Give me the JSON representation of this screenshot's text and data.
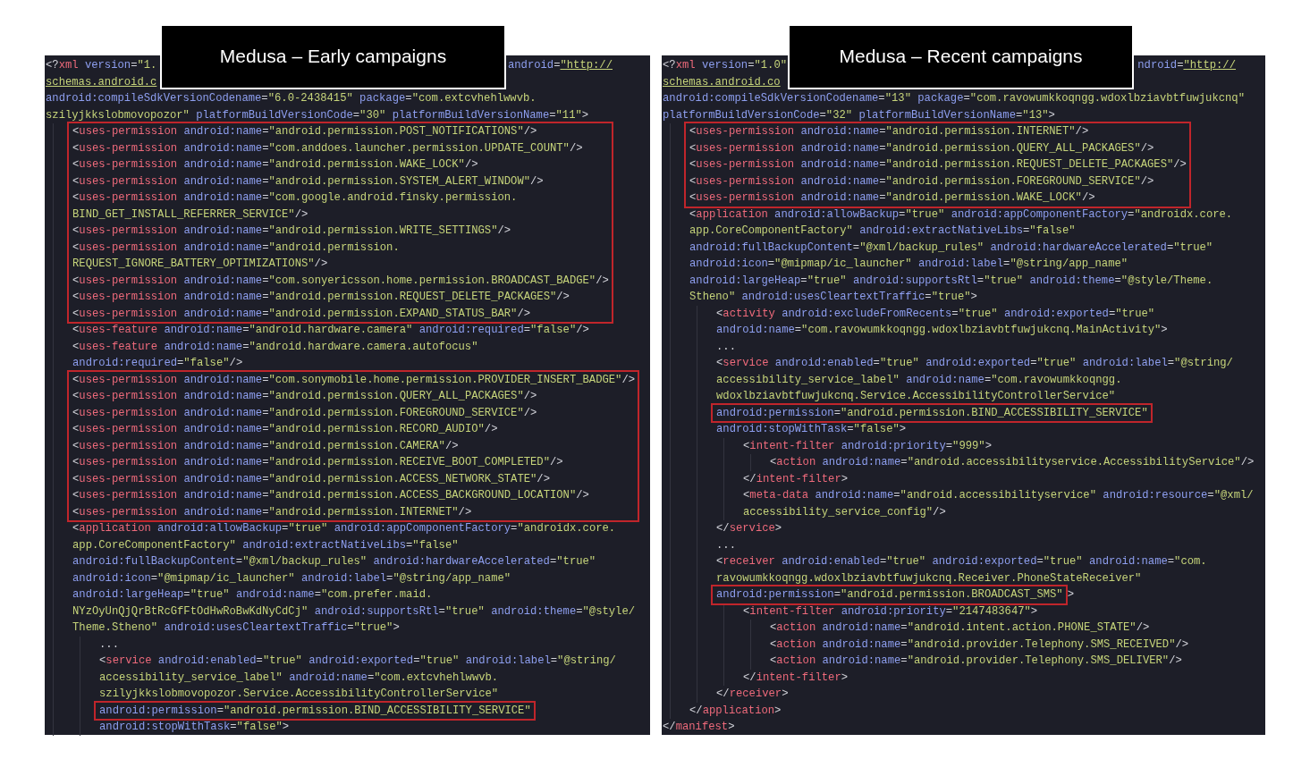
{
  "panels": [
    {
      "title": "Medusa – Early campaigns",
      "code": [
        {
          "kind": "split",
          "parts": [
            {
              "text": "<?xml version=\"1."
            },
            {
              "text": "android=\"http://",
              "link": true
            }
          ]
        },
        {
          "kind": "line",
          "text": "schemas.android.c",
          "starts_in_value": true,
          "link": true
        },
        {
          "kind": "line",
          "text": "android:compileSdkVersionCodename=\"6.0-2438415\" package=\"com.extcvhehlwwvb."
        },
        {
          "kind": "line",
          "text": "szilyjkkslobmovopozor\" platformBuildVersionCode=\"30\" platformBuildVersionName=\"11\">",
          "starts_in_value": true,
          "children": [
            {
              "kind": "highlight",
              "lines": [
                {
                  "text": "<uses-permission android:name=\"android.permission.POST_NOTIFICATIONS\"/>"
                },
                {
                  "text": "<uses-permission android:name=\"com.anddoes.launcher.permission.UPDATE_COUNT\"/>"
                },
                {
                  "text": "<uses-permission android:name=\"android.permission.WAKE_LOCK\"/>"
                },
                {
                  "text": "<uses-permission android:name=\"android.permission.SYSTEM_ALERT_WINDOW\"/>"
                },
                {
                  "text": "<uses-permission android:name=\"com.google.android.finsky.permission."
                },
                {
                  "text": "BIND_GET_INSTALL_REFERRER_SERVICE\"/>",
                  "starts_in_value": true
                },
                {
                  "text": "<uses-permission android:name=\"android.permission.WRITE_SETTINGS\"/>"
                },
                {
                  "text": "<uses-permission android:name=\"android.permission."
                },
                {
                  "text": "REQUEST_IGNORE_BATTERY_OPTIMIZATIONS\"/>",
                  "starts_in_value": true
                },
                {
                  "text": "<uses-permission android:name=\"com.sonyericsson.home.permission.BROADCAST_BADGE\"/>"
                },
                {
                  "text": "<uses-permission android:name=\"android.permission.REQUEST_DELETE_PACKAGES\"/>"
                },
                {
                  "text": "<uses-permission android:name=\"android.permission.EXPAND_STATUS_BAR\"/>"
                }
              ]
            },
            {
              "kind": "line",
              "text": "<uses-feature android:name=\"android.hardware.camera\" android:required=\"false\"/>"
            },
            {
              "kind": "line",
              "text": "<uses-feature android:name=\"android.hardware.camera.autofocus\""
            },
            {
              "kind": "line",
              "text": "android:required=\"false\"/>"
            },
            {
              "kind": "highlight",
              "lines": [
                {
                  "text": "<uses-permission android:name=\"com.sonymobile.home.permission.PROVIDER_INSERT_BADGE\"/>"
                },
                {
                  "text": "<uses-permission android:name=\"android.permission.QUERY_ALL_PACKAGES\"/>"
                },
                {
                  "text": "<uses-permission android:name=\"android.permission.FOREGROUND_SERVICE\"/>"
                },
                {
                  "text": "<uses-permission android:name=\"android.permission.RECORD_AUDIO\"/>"
                },
                {
                  "text": "<uses-permission android:name=\"android.permission.CAMERA\"/>"
                },
                {
                  "text": "<uses-permission android:name=\"android.permission.RECEIVE_BOOT_COMPLETED\"/>"
                },
                {
                  "text": "<uses-permission android:name=\"android.permission.ACCESS_NETWORK_STATE\"/>"
                },
                {
                  "text": "<uses-permission android:name=\"android.permission.ACCESS_BACKGROUND_LOCATION\"/>"
                },
                {
                  "text": "<uses-permission android:name=\"android.permission.INTERNET\"/>"
                }
              ]
            },
            {
              "kind": "line",
              "text": "<application android:allowBackup=\"true\" android:appComponentFactory=\"androidx.core."
            },
            {
              "kind": "line",
              "text": "app.CoreComponentFactory\" android:extractNativeLibs=\"false\"",
              "starts_in_value": true
            },
            {
              "kind": "line",
              "text": "android:fullBackupContent=\"@xml/backup_rules\" android:hardwareAccelerated=\"true\""
            },
            {
              "kind": "line",
              "text": "android:icon=\"@mipmap/ic_launcher\" android:label=\"@string/app_name\""
            },
            {
              "kind": "line",
              "text": "android:largeHeap=\"true\" android:name=\"com.prefer.maid."
            },
            {
              "kind": "line",
              "text": "NYzOyUnQjQrBtRcGfFtOdHwRoBwKdNyCdCj\" android:supportsRtl=\"true\" android:theme=\"@style/",
              "starts_in_value": true
            },
            {
              "kind": "line",
              "text": "Theme.Stheno\" android:usesCleartextTraffic=\"true\">",
              "starts_in_value": true,
              "children": [
                {
                  "kind": "line",
                  "text": "..."
                },
                {
                  "kind": "line",
                  "text": "<service android:enabled=\"true\" android:exported=\"true\" android:label=\"@string/"
                },
                {
                  "kind": "line",
                  "text": "accessibility_service_label\" android:name=\"com.extcvhehlwwvb.",
                  "starts_in_value": true
                },
                {
                  "kind": "line",
                  "text": "szilyjkkslobmovopozor.Service.AccessibilityControllerService\"",
                  "starts_in_value": true
                },
                {
                  "kind": "highlight",
                  "lines": [
                    {
                      "text": "android:permission=\"android.permission.BIND_ACCESSIBILITY_SERVICE\""
                    }
                  ]
                },
                {
                  "kind": "line",
                  "text": "android:stopWithTask=\"false\">"
                }
              ]
            }
          ]
        }
      ]
    },
    {
      "title": "Medusa – Recent campaigns",
      "code": [
        {
          "kind": "split",
          "parts": [
            {
              "text": "<?xml version=\"1.0\""
            },
            {
              "text": "ndroid=\"http://",
              "link": true
            }
          ]
        },
        {
          "kind": "line",
          "text": "schemas.android.co",
          "starts_in_value": true,
          "link": true
        },
        {
          "kind": "line",
          "text": "android:compileSdkVersionCodename=\"13\" package=\"com.ravowumkkoqngg.wdoxlbziavbtfuwjukcnq\""
        },
        {
          "kind": "line",
          "text": "platformBuildVersionCode=\"32\" platformBuildVersionName=\"13\">",
          "children": [
            {
              "kind": "highlight",
              "lines": [
                {
                  "text": "<uses-permission android:name=\"android.permission.INTERNET\"/>"
                },
                {
                  "text": "<uses-permission android:name=\"android.permission.QUERY_ALL_PACKAGES\"/>"
                },
                {
                  "text": "<uses-permission android:name=\"android.permission.REQUEST_DELETE_PACKAGES\"/>"
                },
                {
                  "text": "<uses-permission android:name=\"android.permission.FOREGROUND_SERVICE\"/>"
                },
                {
                  "text": "<uses-permission android:name=\"android.permission.WAKE_LOCK\"/>"
                }
              ]
            },
            {
              "kind": "line",
              "text": "<application android:allowBackup=\"true\" android:appComponentFactory=\"androidx.core."
            },
            {
              "kind": "line",
              "text": "app.CoreComponentFactory\" android:extractNativeLibs=\"false\"",
              "starts_in_value": true
            },
            {
              "kind": "line",
              "text": "android:fullBackupContent=\"@xml/backup_rules\" android:hardwareAccelerated=\"true\""
            },
            {
              "kind": "line",
              "text": "android:icon=\"@mipmap/ic_launcher\" android:label=\"@string/app_name\""
            },
            {
              "kind": "line",
              "text": "android:largeHeap=\"true\" android:supportsRtl=\"true\" android:theme=\"@style/Theme."
            },
            {
              "kind": "line",
              "text": "Stheno\" android:usesCleartextTraffic=\"true\">",
              "starts_in_value": true,
              "children": [
                {
                  "kind": "line",
                  "text": "<activity android:excludeFromRecents=\"true\" android:exported=\"true\""
                },
                {
                  "kind": "line",
                  "text": "android:name=\"com.ravowumkkoqngg.wdoxlbziavbtfuwjukcnq.MainActivity\">"
                },
                {
                  "kind": "line",
                  "text": "..."
                },
                {
                  "kind": "line",
                  "text": "<service android:enabled=\"true\" android:exported=\"true\" android:label=\"@string/"
                },
                {
                  "kind": "line",
                  "text": "accessibility_service_label\" android:name=\"com.ravowumkkoqngg.",
                  "starts_in_value": true
                },
                {
                  "kind": "line",
                  "text": "wdoxlbziavbtfuwjukcnq.Service.AccessibilityControllerService\"",
                  "starts_in_value": true
                },
                {
                  "kind": "highlight",
                  "lines": [
                    {
                      "text": "android:permission=\"android.permission.BIND_ACCESSIBILITY_SERVICE\""
                    }
                  ]
                },
                {
                  "kind": "line",
                  "text": "android:stopWithTask=\"false\">",
                  "children": [
                    {
                      "kind": "line",
                      "text": "<intent-filter android:priority=\"999\">",
                      "children": [
                        {
                          "kind": "line",
                          "text": "<action android:name=\"android.accessibilityservice.AccessibilityService\"/>"
                        }
                      ]
                    },
                    {
                      "kind": "line",
                      "text": "</intent-filter>"
                    },
                    {
                      "kind": "line",
                      "text": "<meta-data android:name=\"android.accessibilityservice\" android:resource=\"@xml/"
                    },
                    {
                      "kind": "line",
                      "text": "accessibility_service_config\"/>",
                      "starts_in_value": true
                    }
                  ]
                },
                {
                  "kind": "line",
                  "text": "</service>"
                },
                {
                  "kind": "line",
                  "text": "..."
                },
                {
                  "kind": "line",
                  "text": "<receiver android:enabled=\"true\" android:exported=\"true\" android:name=\"com."
                },
                {
                  "kind": "line",
                  "text": "ravowumkkoqngg.wdoxlbziavbtfuwjukcnq.Receiver.PhoneStateReceiver\"",
                  "starts_in_value": true
                },
                {
                  "kind": "highlight",
                  "lines": [
                    {
                      "text": "android:permission=\"android.permission.BROADCAST_SMS\""
                    }
                  ],
                  "tail": ">",
                  "children": [
                    {
                      "kind": "line",
                      "text": "<intent-filter android:priority=\"2147483647\">",
                      "children": [
                        {
                          "kind": "line",
                          "text": "<action android:name=\"android.intent.action.PHONE_STATE\"/>"
                        },
                        {
                          "kind": "line",
                          "text": "<action android:name=\"android.provider.Telephony.SMS_RECEIVED\"/>"
                        },
                        {
                          "kind": "line",
                          "text": "<action android:name=\"android.provider.Telephony.SMS_DELIVER\"/>"
                        }
                      ]
                    },
                    {
                      "kind": "line",
                      "text": "</intent-filter>"
                    }
                  ]
                },
                {
                  "kind": "line",
                  "text": "</receiver>"
                }
              ]
            },
            {
              "kind": "line",
              "text": "</application>"
            }
          ]
        },
        {
          "kind": "line",
          "text": "</manifest>"
        }
      ]
    }
  ]
}
